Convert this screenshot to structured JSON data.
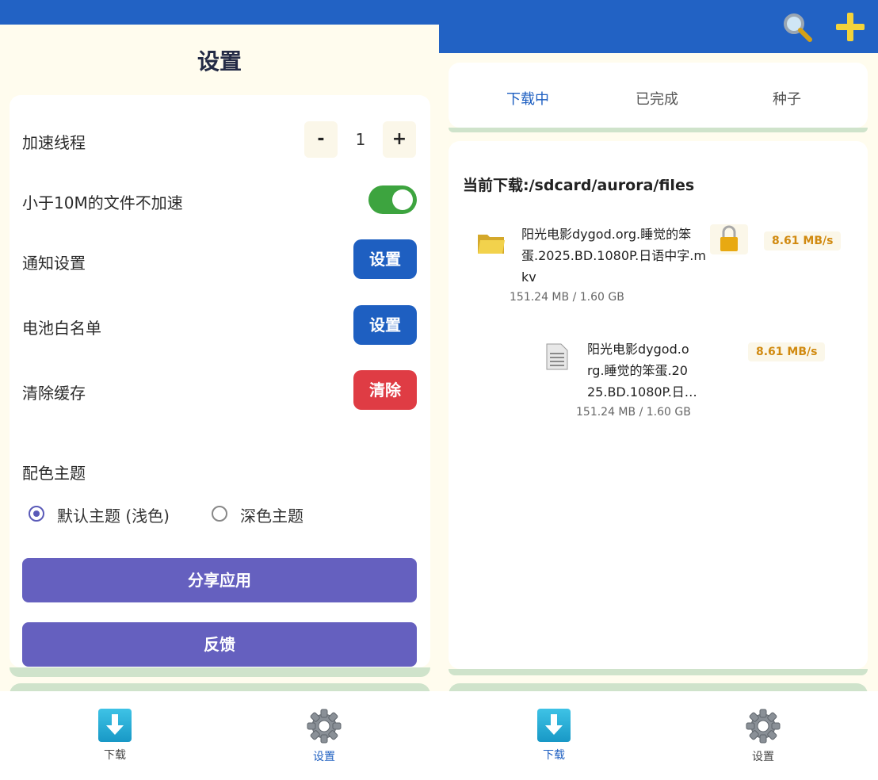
{
  "settings": {
    "title": "设置",
    "threads_label": "加速线程",
    "threads_minus": "-",
    "threads_value": "1",
    "threads_plus": "+",
    "small_file_label": "小于10M的文件不加速",
    "small_file_enabled": true,
    "notify_label": "通知设置",
    "notify_button": "设置",
    "battery_label": "电池白名单",
    "battery_button": "设置",
    "cache_label": "清除缓存",
    "cache_button": "清除",
    "theme_label": "配色主题",
    "theme_options": [
      {
        "label": "默认主题 (浅色)",
        "selected": true
      },
      {
        "label": "深色主题",
        "selected": false
      }
    ],
    "share_button": "分享应用",
    "feedback_button": "反馈"
  },
  "nav_left": {
    "download_label": "下载",
    "settings_label": "设置",
    "active": "settings"
  },
  "downloads": {
    "tabs": [
      "下载中",
      "已完成",
      "种子"
    ],
    "active_tab": "下载中",
    "current_path": "当前下载:/sdcard/aurora/files",
    "items": [
      {
        "name_lines": [
          "阳光电影dygod.org.睡觉的笨",
          "蛋.2025.BD.1080P.日语中字.m",
          "kv"
        ],
        "size": "151.24 MB / 1.60 GB",
        "speed": "8.61 MB/s",
        "icon": "folder-icon"
      },
      {
        "name_lines": [
          "阳光电影dygod.o",
          "rg.睡觉的笨蛋.20",
          "25.BD.1080P.日…"
        ],
        "size": "151.24 MB / 1.60 GB",
        "speed": "8.61 MB/s",
        "icon": "document-icon"
      }
    ]
  },
  "nav_right": {
    "download_label": "下载",
    "settings_label": "设置",
    "active": "download"
  },
  "colors": {
    "primary": "#2262c4",
    "toggle_on": "#3da43f",
    "danger": "#df3c44",
    "accent_purple": "#6560bf",
    "speed_text": "#d18a10"
  }
}
